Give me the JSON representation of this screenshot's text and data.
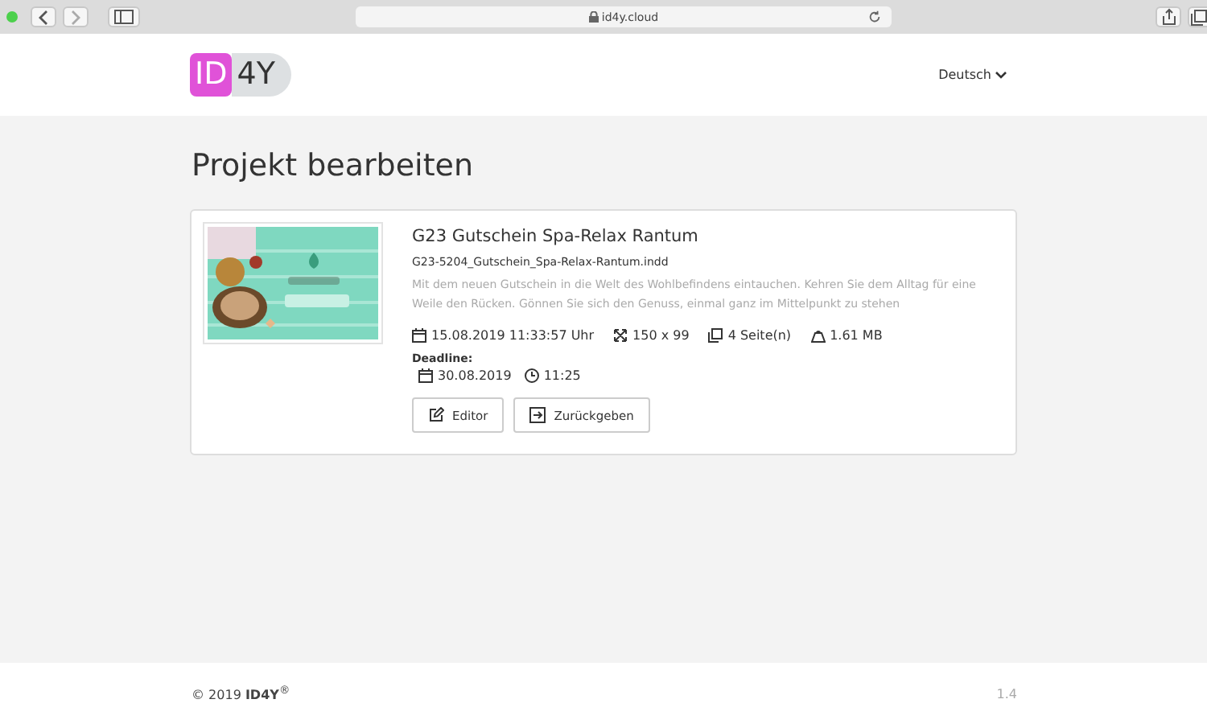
{
  "browser": {
    "url": "id4y.cloud"
  },
  "header": {
    "logo": {
      "part_1": "ID",
      "part_2": "4Y"
    },
    "language": "Deutsch"
  },
  "page_title": "Projekt bearbeiten",
  "project": {
    "title": "G23 Gutschein Spa-Relax Rantum",
    "filename": "G23-5204_Gutschein_Spa-Relax-Rantum.indd",
    "description": "Mit dem neuen Gutschein in die Welt des Wohlbefindens eintauchen. Kehren Sie dem Alltag für eine Weile den Rücken. Gönnen Sie sich den Genuss, einmal ganz im Mittelpunkt zu stehen",
    "meta": [
      {
        "kind": "date",
        "text": "15.08.2019 11:33:57 Uhr"
      },
      {
        "kind": "size",
        "text": "150 x 99"
      },
      {
        "kind": "pages",
        "text": "4 Seite(n)"
      },
      {
        "kind": "weight",
        "text": "1.61 MB"
      }
    ],
    "deadline_label": "Deadline:",
    "deadline": [
      {
        "kind": "date",
        "text": "30.08.2019"
      },
      {
        "kind": "time",
        "text": "11:25"
      }
    ],
    "buttons": [
      {
        "kind": "edit",
        "label": "Editor"
      },
      {
        "kind": "return",
        "label": "Zurückgeben"
      }
    ]
  },
  "footer": {
    "copyright": "© 2019 **ID4Y**$^{®}$",
    "version": "1.4"
  }
}
